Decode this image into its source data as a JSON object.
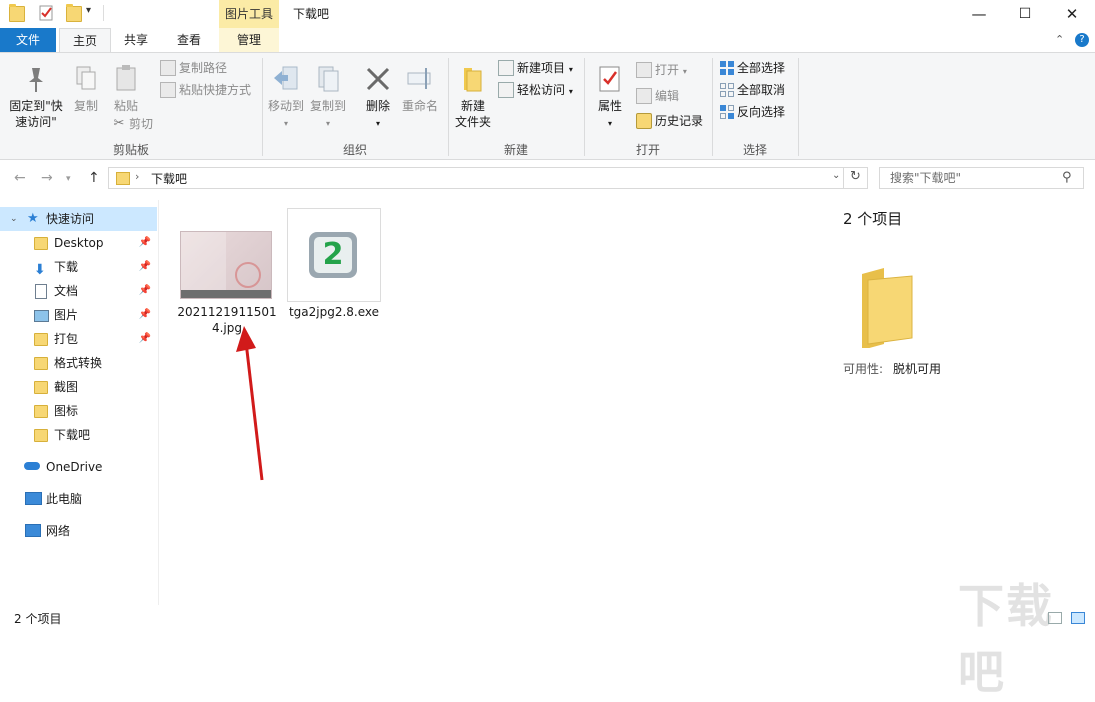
{
  "window": {
    "title": "下载吧",
    "contextual_tab_title": "图片工具",
    "minimize": "—",
    "maximize": "☐",
    "close": "✕"
  },
  "tabs": {
    "file": "文件",
    "home": "主页",
    "share": "共享",
    "view": "查看",
    "manage": "管理"
  },
  "ribbon": {
    "clipboard": {
      "label": "剪贴板",
      "pin_quick_access_line1": "固定到\"快",
      "pin_quick_access_line2": "速访问\"",
      "copy": "复制",
      "paste": "粘贴",
      "copy_path": "复制路径",
      "paste_shortcut": "粘贴快捷方式",
      "cut": "剪切"
    },
    "organize": {
      "label": "组织",
      "move_to": "移动到",
      "copy_to": "复制到",
      "delete": "删除",
      "rename": "重命名"
    },
    "new": {
      "label": "新建",
      "new_folder_line1": "新建",
      "new_folder_line2": "文件夹",
      "new_item": "新建项目",
      "easy_access": "轻松访问"
    },
    "open": {
      "label": "打开",
      "properties": "属性",
      "open": "打开",
      "edit": "编辑",
      "history": "历史记录"
    },
    "select": {
      "label": "选择",
      "select_all": "全部选择",
      "select_none": "全部取消",
      "invert": "反向选择"
    }
  },
  "address": {
    "crumb": "下载吧",
    "search_placeholder": "搜索\"下载吧\""
  },
  "nav": {
    "quick_access": "快速访问",
    "items": [
      {
        "label": "Desktop",
        "pinned": true,
        "icon": "folder-blue"
      },
      {
        "label": "下载",
        "pinned": true,
        "icon": "download"
      },
      {
        "label": "文档",
        "pinned": true,
        "icon": "document"
      },
      {
        "label": "图片",
        "pinned": true,
        "icon": "picture"
      },
      {
        "label": "打包",
        "pinned": true,
        "icon": "folder"
      },
      {
        "label": "格式转换",
        "pinned": false,
        "icon": "folder"
      },
      {
        "label": "截图",
        "pinned": false,
        "icon": "folder"
      },
      {
        "label": "图标",
        "pinned": false,
        "icon": "folder"
      },
      {
        "label": "下载吧",
        "pinned": false,
        "icon": "folder"
      }
    ],
    "onedrive": "OneDrive",
    "this_pc": "此电脑",
    "network": "网络"
  },
  "files": [
    {
      "name_line1": "2021121911501",
      "name_line2": "4.jpg",
      "type": "image"
    },
    {
      "name_line1": "tga2jpg2.8.exe",
      "name_line2": "",
      "type": "exe"
    }
  ],
  "details": {
    "count": "2 个项目",
    "availability_label": "可用性:",
    "availability_value": "脱机可用"
  },
  "status": {
    "count": "2 个项目"
  },
  "watermark": {
    "text": "下载吧"
  },
  "colors": {
    "file_tab": "#1979ca",
    "context_tab": "#fbeba6",
    "selection": "#cce8ff",
    "folder": "#f7d774",
    "arrow": "#d11a1a"
  }
}
